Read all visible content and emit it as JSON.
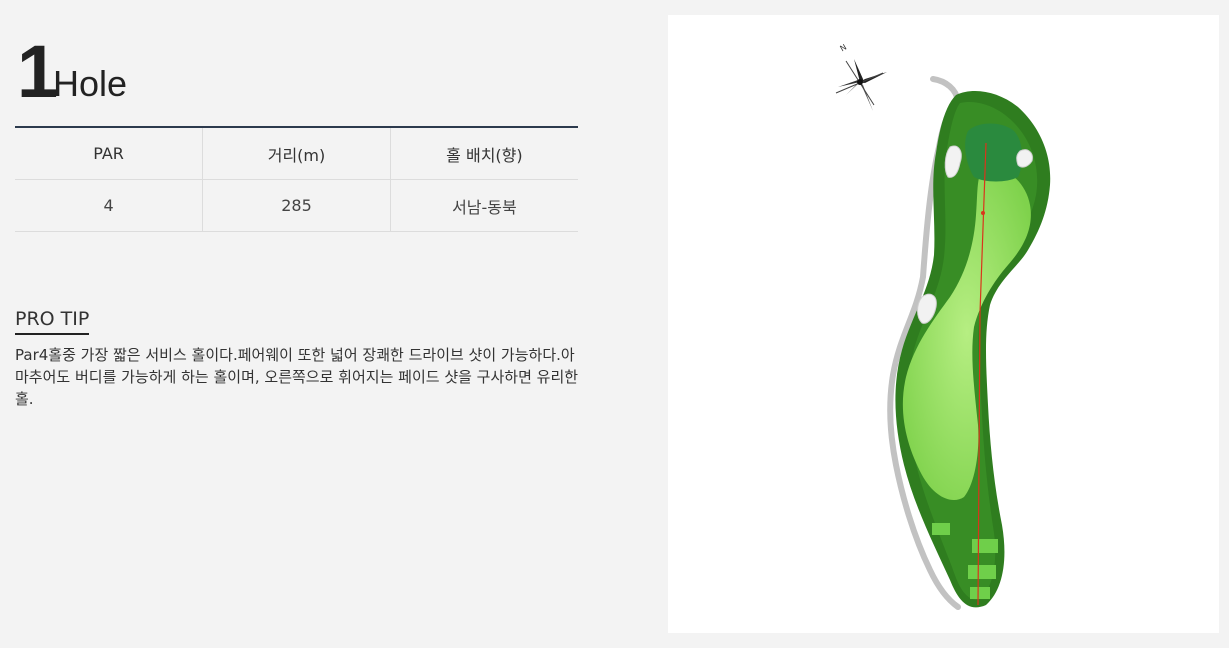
{
  "hole": {
    "number": "1",
    "label": "Hole"
  },
  "info_table": {
    "headers": [
      "PAR",
      "거리(m)",
      "홀 배치(향)"
    ],
    "values": [
      "4",
      "285",
      "서남-동북"
    ]
  },
  "pro_tip": {
    "heading": "PRO TIP",
    "text": "Par4홀중 가장 짧은 서비스 홀이다.페어웨이 또한 넓어 장쾌한 드라이브 샷이 가능하다.아마추어도 버디를 가능하게 하는 홀이며, 오른쪽으로 휘어지는 페이드 샷을 구사하면 유리한 홀."
  },
  "map": {
    "compass_label": "N",
    "colors": {
      "rough": "#2f7d1f",
      "fairway": "#8edb5b",
      "green": "#2a8a3e",
      "bunker": "#f2f2f2",
      "cart_path": "#b8b8b8",
      "aim_line": "#d9351b"
    }
  }
}
